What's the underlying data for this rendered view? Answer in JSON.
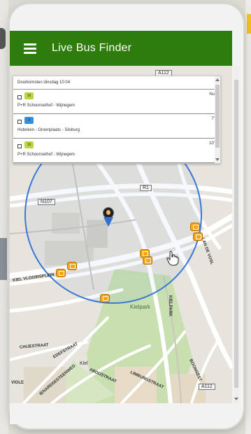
{
  "app": {
    "title": "Live Bus Finder"
  },
  "departures": {
    "header": "Doorkomsten dinsdag 10:04",
    "rows": [
      {
        "line": "16",
        "line_color": "#b9d63a",
        "destination": "P+R Schoonselhof - Wijnegem",
        "eta": "Nu"
      },
      {
        "line": "4",
        "line_color": "#2f8fe0",
        "destination": "Hoboken - Groenplaats - Silsburg",
        "eta": "7'"
      },
      {
        "line": "16",
        "line_color": "#b9d63a",
        "destination": "P+R Schoonselhof - Wijnegem",
        "eta": "10'"
      }
    ]
  },
  "map": {
    "labels": {
      "n107": "N107",
      "r1": "R1",
      "a112_top": "A112",
      "a112_bottom": "A112",
      "kielpark": "Kielpark",
      "kielparklaan": "KIELPARK",
      "kiel": "Kiel",
      "vlooier": "KIEL VLOOIRSPLEIN",
      "abdijstraat": "ABDIJSTRAAT",
      "limburgstraat": "LIMBURGSTRAAT",
      "chijestraat": "CHIJESTRAAT",
      "edefstraat": "EDEFSTRAAT",
      "vdsteenweg": "IENARDSESTEENWEG",
      "vioie": "VIOLE",
      "vosl": "LAN DE VOSL",
      "boomsestr": "BOOMSEST",
      "gfiver": "VIOLE"
    },
    "icons": {
      "user_pin": "location-pin-icon",
      "bus_stop": "bus-stop-icon",
      "cursor": "hand-cursor-icon"
    },
    "radius_color": "#3a78d8",
    "park_color": "#c8dfb0"
  }
}
